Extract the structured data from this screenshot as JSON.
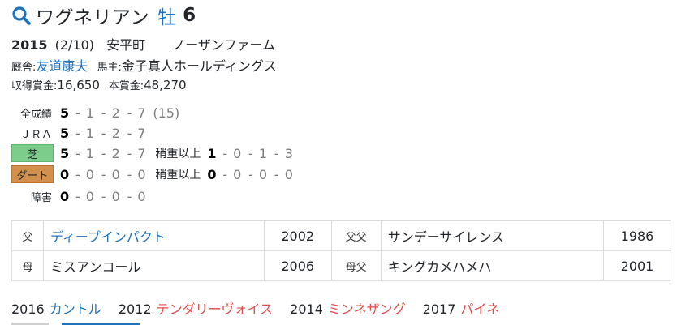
{
  "header": {
    "name": "ワグネリアン",
    "sex": "牡",
    "age": "6",
    "accent": "#1e73be"
  },
  "profile": {
    "birth_year": "2015",
    "birth_date": "(2/10)",
    "region": "安平町",
    "breeder": "ノーザンファーム",
    "trainer_label": "厩舎",
    "trainer": "友道康夫",
    "owner_label": "馬主",
    "owner": "金子真人ホールディングス",
    "earnings_label": "収得賞金",
    "earnings": "16,650",
    "prize_label": "本賞金",
    "prize": "48,270"
  },
  "records": [
    {
      "label": "全成績",
      "style": "plain",
      "values": [
        "5",
        "1",
        "2",
        "7"
      ],
      "extra": "(15)"
    },
    {
      "label": "ＪＲＡ",
      "style": "plain",
      "values": [
        "5",
        "1",
        "2",
        "7"
      ]
    },
    {
      "label": "芝",
      "style": "turf",
      "color": "#7ccd8b",
      "values": [
        "5",
        "1",
        "2",
        "7"
      ],
      "heavy_label": "稍重以上",
      "heavy": [
        "1",
        "0",
        "1",
        "3"
      ]
    },
    {
      "label": "ダート",
      "style": "dirt",
      "color": "#d1904e",
      "values": [
        "0",
        "0",
        "0",
        "0"
      ],
      "heavy_label": "稍重以上",
      "heavy": [
        "0",
        "0",
        "0",
        "0"
      ]
    },
    {
      "label": "障害",
      "style": "plain",
      "values": [
        "0",
        "0",
        "0",
        "0"
      ]
    }
  ],
  "pedigree": [
    {
      "rel": "父",
      "name": "ディープインパクト",
      "year": "2002",
      "rel2": "父父",
      "name2": "サンデーサイレンス",
      "year2": "1986"
    },
    {
      "rel": "母",
      "name": "ミスアンコール",
      "year": "2006",
      "rel2": "母父",
      "name2": "キングカメハメハ",
      "year2": "2001"
    }
  ],
  "offspring": [
    {
      "year": "2016",
      "name": "カントル",
      "color": "#1e73be"
    },
    {
      "year": "2012",
      "name": "テンダリーヴォイス",
      "color": "#e24b4b"
    },
    {
      "year": "2014",
      "name": "ミンネザング",
      "color": "#e24b4b"
    },
    {
      "year": "2017",
      "name": "パイネ",
      "color": "#e24b4b"
    }
  ]
}
